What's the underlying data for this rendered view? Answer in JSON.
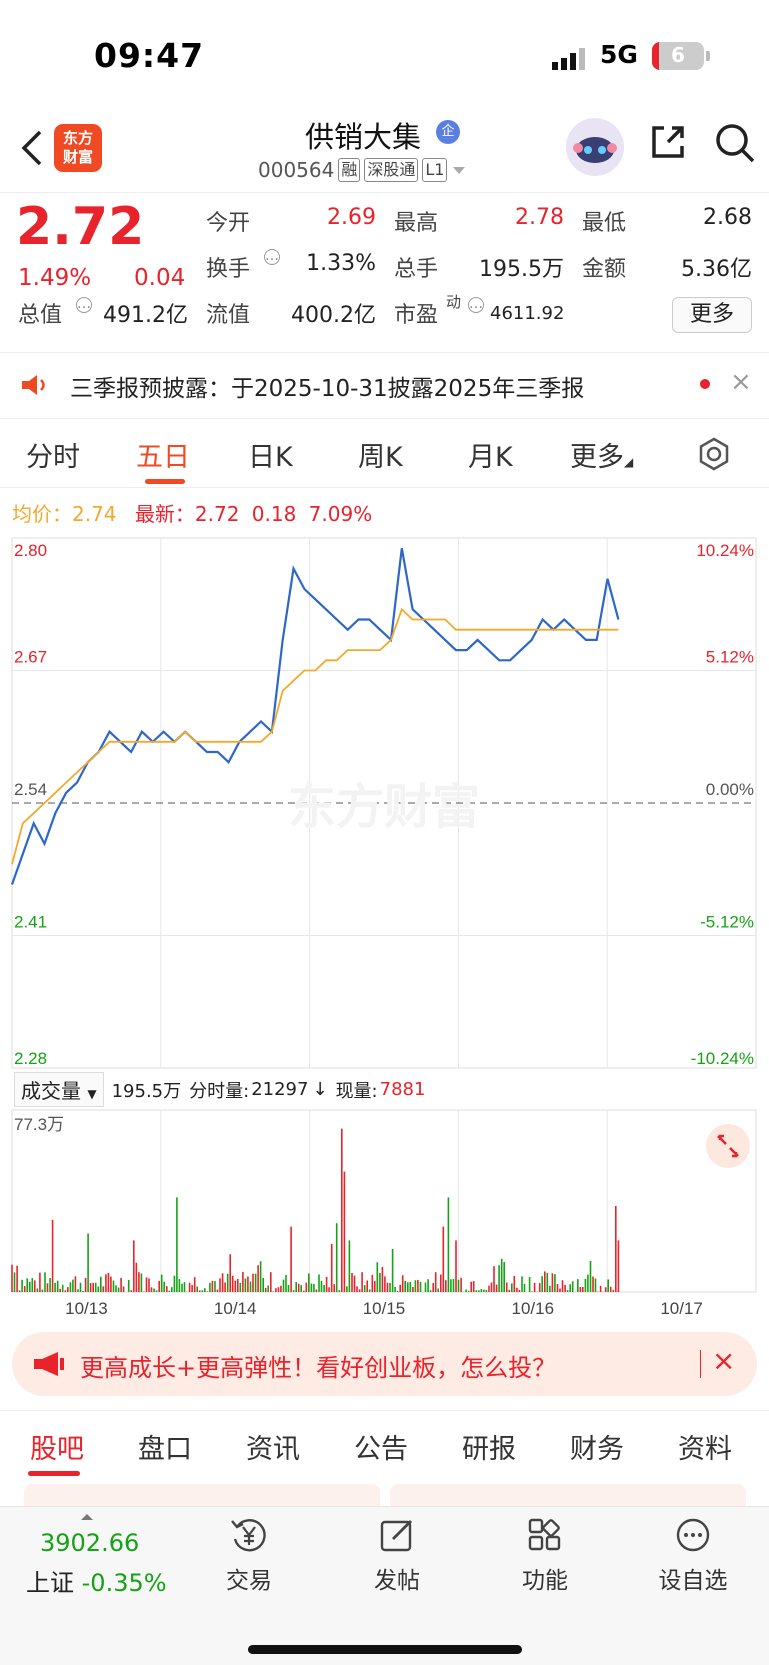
{
  "status_bar": {
    "time": "09:47",
    "network": "5G",
    "battery": "6"
  },
  "header": {
    "logo_text": "东方\n财富",
    "stock_name": "供销大集",
    "badge": "企",
    "code": "000564",
    "tags": [
      "融",
      "深股通",
      "L1"
    ]
  },
  "quote": {
    "price": "2.72",
    "change_pct": "1.49%",
    "change": "0.04",
    "fields": [
      {
        "label": "今开",
        "value": "2.69",
        "color": "#e8232b"
      },
      {
        "label": "最高",
        "value": "2.78",
        "color": "#e8232b"
      },
      {
        "label": "最低",
        "value": "2.68",
        "color": "#222222"
      },
      {
        "label": "换手",
        "value": "1.33%",
        "color": "#222222"
      },
      {
        "label": "总手",
        "value": "195.5万",
        "color": "#222222"
      },
      {
        "label": "金额",
        "value": "5.36亿",
        "color": "#222222"
      },
      {
        "label": "总值",
        "value": "491.2亿",
        "color": "#222222"
      },
      {
        "label": "流值",
        "value": "400.2亿",
        "color": "#222222"
      },
      {
        "label": "市盈",
        "value": "4611.92",
        "color": "#222222",
        "superscript": "动"
      }
    ],
    "more_label": "更多"
  },
  "notice": {
    "text": "三季报预披露：于2025-10-31披露2025年三季报",
    "close": "×"
  },
  "chart_tabs": [
    "分时",
    "五日",
    "日K",
    "周K",
    "月K",
    "更多"
  ],
  "chart_header": {
    "avg_label": "均价：2.74",
    "latest_label": "最新：2.72",
    "latest_change": "0.18",
    "latest_pct": "7.09%"
  },
  "chart_data": {
    "type": "line",
    "title": "",
    "x": [
      "10/13",
      "10/14",
      "10/15",
      "10/16",
      "10/17"
    ],
    "ylim": [
      2.28,
      2.8
    ],
    "y_ticks_left": [
      "2.80",
      "2.67",
      "2.54",
      "2.41",
      "2.28"
    ],
    "y_ticks_right": [
      "10.24%",
      "5.12%",
      "0.00%",
      "-5.12%",
      "-10.24%"
    ],
    "prev_close": 2.54,
    "series": [
      {
        "name": "",
        "color": "#2e67c9",
        "values": [
          2.46,
          2.49,
          2.52,
          2.5,
          2.53,
          2.55,
          2.56,
          2.58,
          2.59,
          2.61,
          2.6,
          2.59,
          2.61,
          2.6,
          2.61,
          2.6,
          2.61,
          2.6,
          2.59,
          2.59,
          2.58,
          2.6,
          2.61,
          2.62,
          2.61,
          2.7,
          2.77,
          2.75,
          2.74,
          2.73,
          2.72,
          2.71,
          2.72,
          2.72,
          2.71,
          2.7,
          2.79,
          2.73,
          2.72,
          2.71,
          2.7,
          2.69,
          2.69,
          2.7,
          2.69,
          2.68,
          2.68,
          2.69,
          2.7,
          2.72,
          2.71,
          2.72,
          2.71,
          2.7,
          2.7,
          2.76,
          2.72
        ]
      },
      {
        "name": "",
        "color": "#f2a92c",
        "values": [
          2.48,
          2.52,
          2.53,
          2.54,
          2.55,
          2.56,
          2.57,
          2.58,
          2.59,
          2.6,
          2.6,
          2.6,
          2.6,
          2.6,
          2.6,
          2.6,
          2.61,
          2.6,
          2.6,
          2.6,
          2.6,
          2.6,
          2.6,
          2.6,
          2.61,
          2.65,
          2.66,
          2.67,
          2.67,
          2.68,
          2.68,
          2.69,
          2.69,
          2.69,
          2.69,
          2.7,
          2.73,
          2.72,
          2.72,
          2.72,
          2.72,
          2.71,
          2.71,
          2.71,
          2.71,
          2.71,
          2.71,
          2.71,
          2.71,
          2.71,
          2.71,
          2.71,
          2.71,
          2.71,
          2.71,
          2.71,
          2.71
        ]
      }
    ],
    "watermark": "东方财富"
  },
  "volume": {
    "selector": "成交量",
    "total": "195.5万",
    "minute_label": "分时量:",
    "minute_value": "21297",
    "arrow": "↓",
    "now_label": "现量:",
    "now_value": "7881",
    "max_label": "77.3万"
  },
  "promo": {
    "text": "更高成长+更高弹性！看好创业板，怎么投？",
    "close": "×"
  },
  "bottom_tabs": [
    "股吧",
    "盘口",
    "资讯",
    "公告",
    "研报",
    "财务",
    "资料"
  ],
  "toolbar": {
    "index_value": "3902.66",
    "index_name": "上证",
    "index_pct": "-0.35%",
    "items": [
      {
        "label": "交易",
        "icon": "yen-cycle-icon"
      },
      {
        "label": "发帖",
        "icon": "edit-icon"
      },
      {
        "label": "功能",
        "icon": "grid-icon"
      },
      {
        "label": "设自选",
        "icon": "more-dots-icon"
      }
    ]
  }
}
